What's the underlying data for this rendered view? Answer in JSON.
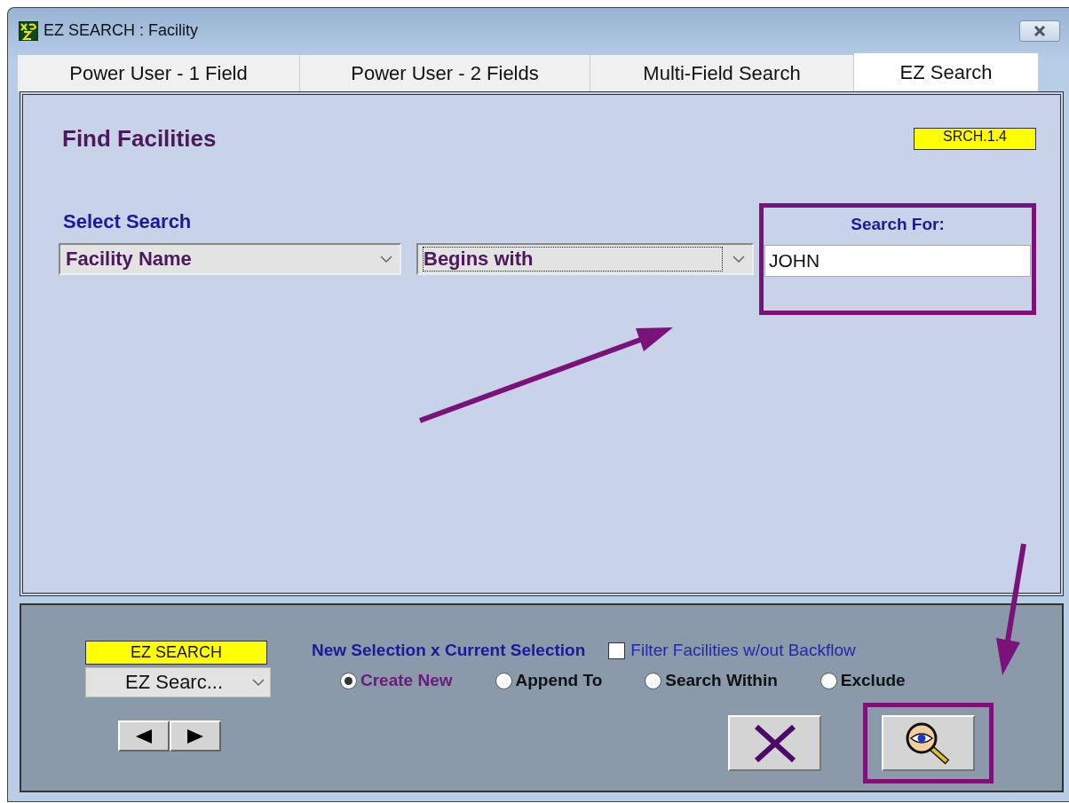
{
  "window": {
    "title": "EZ SEARCH :  Facility"
  },
  "tabs": [
    {
      "label": "Power User - 1 Field",
      "selected": false
    },
    {
      "label": "Power User - 2 Fields",
      "selected": false
    },
    {
      "label": "Multi-Field Search",
      "selected": false
    },
    {
      "label": "EZ Search",
      "selected": true
    }
  ],
  "panel": {
    "heading": "Find Facilities",
    "version": "SRCH.1.4",
    "select_label": "Select Search",
    "field_select": {
      "value": "Facility Name",
      "focused": false
    },
    "operator_select": {
      "value": "Begins with",
      "focused": true
    },
    "search_for": {
      "label": "Search For:",
      "value": "JOHN"
    }
  },
  "footer": {
    "screen_label": "EZ SEARCH",
    "screen_select": {
      "value": "EZ Searc..."
    },
    "selection_label": "New Selection x Current Selection",
    "filter_checkbox": {
      "label": "Filter Facilities w/out Backflow",
      "checked": false
    },
    "modes": [
      {
        "label": "Create New",
        "selected": true
      },
      {
        "label": "Append To",
        "selected": false
      },
      {
        "label": "Search Within",
        "selected": false
      },
      {
        "label": "Exclude",
        "selected": false
      }
    ],
    "buttons": [
      {
        "kind": "clear"
      },
      {
        "kind": "search"
      }
    ]
  }
}
